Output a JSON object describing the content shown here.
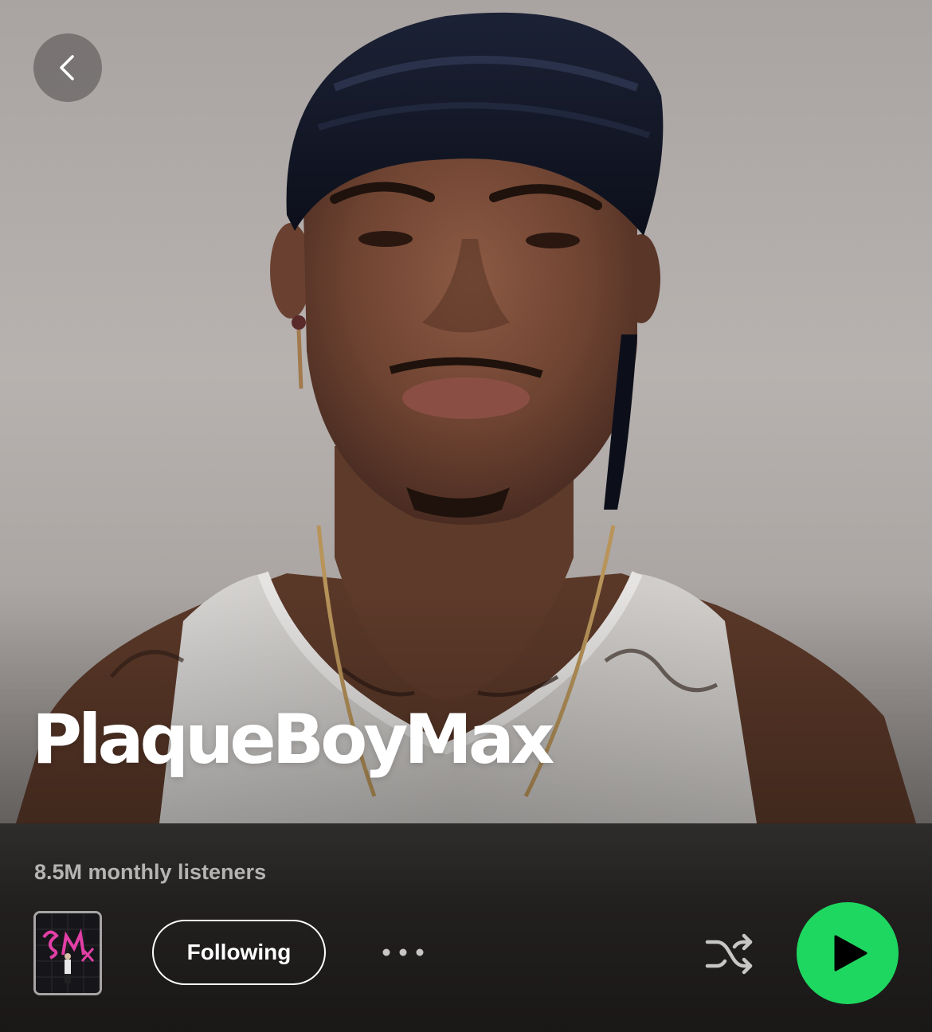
{
  "navigation": {
    "back_icon": "chevron-left-icon"
  },
  "artist": {
    "name": "PlaqueBoyMax",
    "monthly_listeners": "8.5M monthly listeners"
  },
  "actions": {
    "follow_label": "Following",
    "more_icon": "more-options-icon",
    "shuffle_icon": "shuffle-icon",
    "play_icon": "play-icon"
  },
  "colors": {
    "accent": "#1ed760",
    "panel_bg": "#221f1f",
    "text_primary": "#ffffff",
    "text_secondary": "#b6b3b3"
  }
}
